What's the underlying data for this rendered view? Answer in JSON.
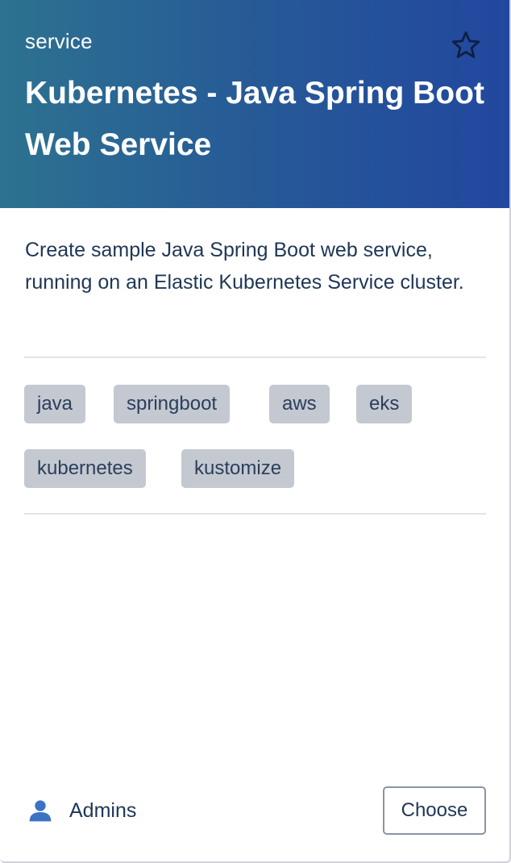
{
  "header": {
    "type_label": "service",
    "title": "Kubernetes - Java Spring Boot Web Service",
    "favorite_icon": "star-outline-icon",
    "gradient_colors": [
      "#2d7290",
      "#22479f"
    ]
  },
  "description": "Create sample Java Spring Boot web service, running on an Elastic Kubernetes Service cluster.",
  "tags": [
    "java",
    "springboot",
    "aws",
    "eks",
    "kubernetes",
    "kustomize"
  ],
  "footer": {
    "owner_icon": "user-icon",
    "owner": "Admins",
    "choose_label": "Choose"
  },
  "colors": {
    "tag_background": "#c4c8d0",
    "text": "#1f3656",
    "owner_icon": "#3b73c4"
  }
}
